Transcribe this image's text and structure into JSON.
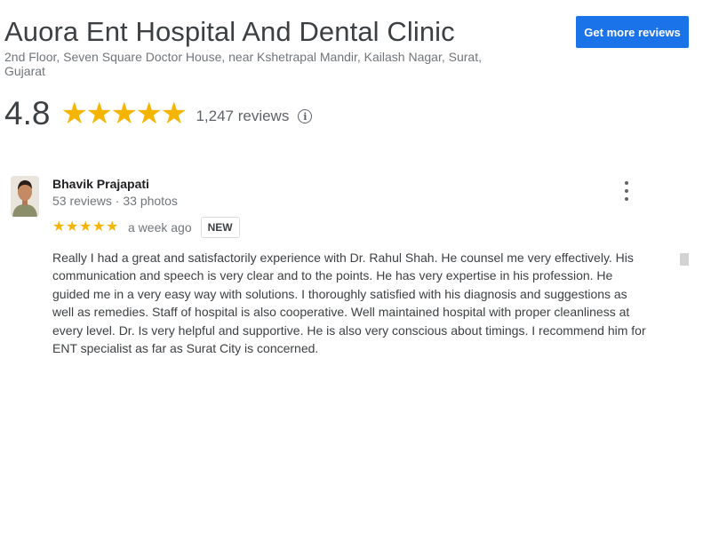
{
  "business": {
    "name": "Auora Ent Hospital And Dental Clinic",
    "address": "2nd Floor, Seven Square Doctor House, near Kshetrapal Mandir, Kailash Nagar, Surat, Gujarat",
    "rating": "4.8",
    "rating_stars": 5,
    "review_count": "1,247 reviews"
  },
  "actions": {
    "get_more_reviews": "Get more reviews"
  },
  "review": {
    "author": "Bhavik Prajapati",
    "author_meta": "53 reviews · 33 photos",
    "stars": 5,
    "date": "a week ago",
    "badge": "NEW",
    "text": "Really I had a great and satisfactorily experience with Dr. Rahul Shah. He counsel me very effectively. His communication and speech is very clear and to the points. He has very expertise in his profession. He guided me in a very easy way with solutions. I thoroughly satisfied with his diagnosis and suggestions as well as remedies. Staff of hospital is also cooperative. Well maintained hospital with proper cleanliness at every level. Dr. Is very helpful and supportive. He is also very conscious about timings. I recommend him for ENT specialist as far as Surat City is concerned."
  },
  "colors": {
    "star": "#f4b400",
    "button": "#1a73e8"
  },
  "icons": {
    "star": "star-icon",
    "info": "info-icon",
    "more": "more-vert-icon"
  }
}
